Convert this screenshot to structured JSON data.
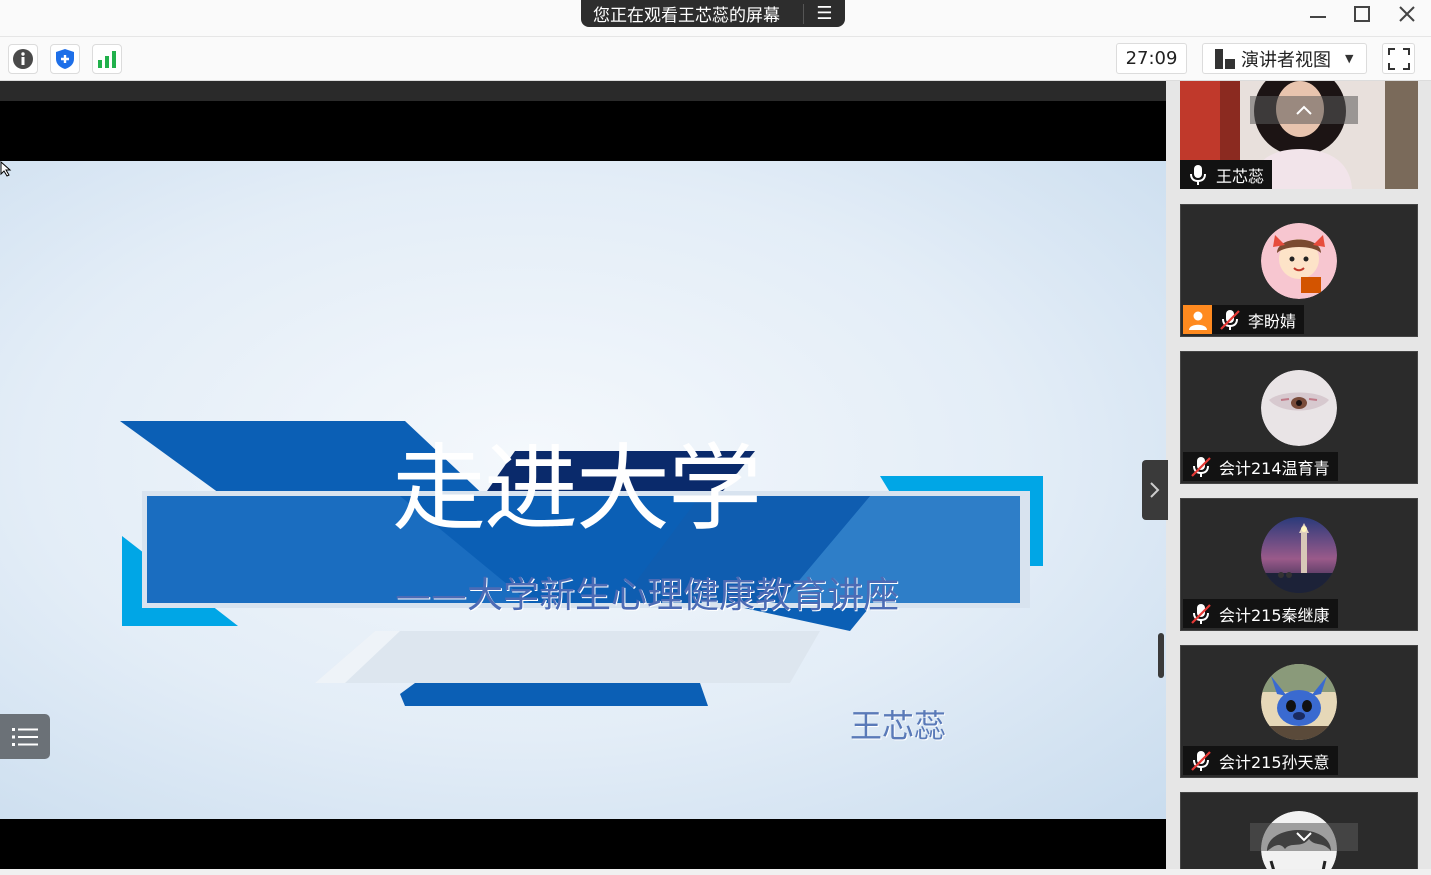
{
  "titlebar": {
    "share_notice": "您正在观看王芯蕊的屏幕",
    "menu_glyph": "☰"
  },
  "toolbar": {
    "icons": [
      "info-icon",
      "shield-icon",
      "signal-bars-icon"
    ],
    "timer": "27:09",
    "view_mode": "演讲者视图"
  },
  "slide": {
    "title": "走进大学",
    "subtitle": "——大学新生心理健康教育讲座",
    "author": "王芯蕊"
  },
  "participants": [
    {
      "name": "王芯蕊",
      "mic": "on",
      "video": true
    },
    {
      "name": "李盼婧",
      "mic": "muted",
      "video": false
    },
    {
      "name": "会计214温育青",
      "mic": "muted",
      "video": false
    },
    {
      "name": "会计215秦继康",
      "mic": "muted",
      "video": false
    },
    {
      "name": "会计215孙天意",
      "mic": "muted",
      "video": false
    }
  ],
  "colors": {
    "slide_blue": "#0b5fb5",
    "slide_navy": "#0a2a6b",
    "slide_cyan": "#00a6e6",
    "tile_bg": "#2b2b2b",
    "accent_green": "#22b14c",
    "accent_blue": "#1e6fe8",
    "avatar_badge": "#ff8a1f"
  }
}
